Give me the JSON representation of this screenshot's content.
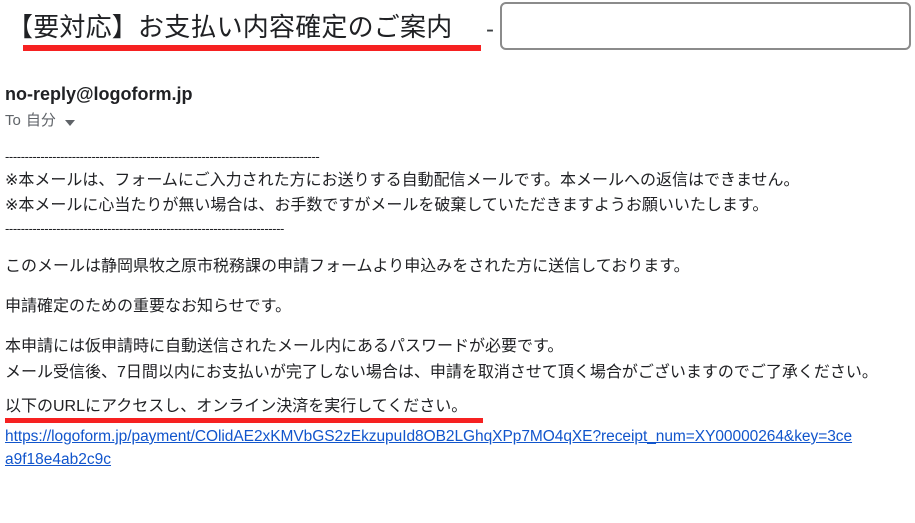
{
  "email": {
    "subject": "【要対応】お支払い内容確定のご案内",
    "subject_separator": "-",
    "masked_field_value": "",
    "sender": "no-reply@logoform.jp",
    "recipient_prefix": "To",
    "recipient": "自分",
    "recipient_caret_icon": "chevron-down-icon"
  },
  "body": {
    "divider_top": "--------------------------------------------------------------------------------",
    "notice_1": "※本メールは、フォームにご入力された方にお送りする自動配信メールです。本メールへの返信はできません。",
    "notice_2": "※本メールに心当たりが無い場合は、お手数ですがメールを破棄していただきますようお願いいたします。",
    "divider_bottom": "-----------------------------------------------------------------------",
    "paragraph_1": "このメールは静岡県牧之原市税務課の申請フォームより申込みをされた方に送信しております。",
    "paragraph_2": "申請確定のための重要なお知らせです。",
    "paragraph_3": "本申請には仮申請時に自動送信されたメール内にあるパスワードが必要です。",
    "paragraph_4": "メール受信後、7日間以内にお支払いが完了しない場合は、申請を取消させて頂く場合がございますのでご了承ください。",
    "cta_text": "以下のURLにアクセスし、オンライン決済を実行してください。"
  },
  "link": {
    "line_1": "https://logoform.jp/payment/COlidAE2xKMVbGS2zEkzupuId8OB2LGhqXPp7MO4qXE?receipt_num=XY00000264&key=3ce",
    "line_2": "a9f18e4ab2c9c"
  },
  "colors": {
    "highlight_red": "#f62121",
    "link_blue": "#1155cc",
    "text": "#202124",
    "muted_text": "#5f6368",
    "box_border": "#8b8b8b"
  }
}
